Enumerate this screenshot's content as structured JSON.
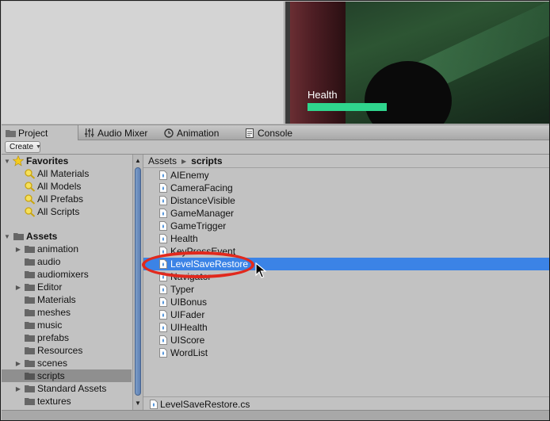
{
  "game_view": {
    "health_label": "Health",
    "health_fill": 1.0
  },
  "tabs": [
    {
      "label": "Project",
      "icon": "folder-icon",
      "active": true
    },
    {
      "label": "Audio Mixer",
      "icon": "audio-mixer-icon"
    },
    {
      "label": "Animation",
      "icon": "animation-clock-icon"
    },
    {
      "label": "Console",
      "icon": "console-icon"
    }
  ],
  "toolbar": {
    "create_label": "Create"
  },
  "tree": {
    "favorites_label": "Favorites",
    "favorites": [
      "All Materials",
      "All Models",
      "All Prefabs",
      "All Scripts"
    ],
    "assets_label": "Assets",
    "assets": [
      {
        "label": "animation",
        "expandable": true
      },
      {
        "label": "audio",
        "expandable": false
      },
      {
        "label": "audiomixers",
        "expandable": false
      },
      {
        "label": "Editor",
        "expandable": true
      },
      {
        "label": "Materials",
        "expandable": false
      },
      {
        "label": "meshes",
        "expandable": false
      },
      {
        "label": "music",
        "expandable": false
      },
      {
        "label": "prefabs",
        "expandable": false
      },
      {
        "label": "Resources",
        "expandable": false
      },
      {
        "label": "scenes",
        "expandable": true
      },
      {
        "label": "scripts",
        "expandable": false,
        "selected": true
      },
      {
        "label": "Standard Assets",
        "expandable": true
      },
      {
        "label": "textures",
        "expandable": false
      }
    ]
  },
  "breadcrumb": {
    "root": "Assets",
    "current": "scripts"
  },
  "files": [
    "AIEnemy",
    "CameraFacing",
    "DistanceVisible",
    "GameManager",
    "GameTrigger",
    "Health",
    "KeyPressEvent",
    "LevelSaveRestore",
    "Navigator",
    "Typer",
    "UIBonus",
    "UIFader",
    "UIHealth",
    "UIScore",
    "WordList"
  ],
  "selected_file": "LevelSaveRestore",
  "status": {
    "selected_path": "LevelSaveRestore.cs"
  },
  "colors": {
    "selection": "#3b83e6",
    "annotation": "#e1291d",
    "health_bar": "#2fd58d"
  }
}
